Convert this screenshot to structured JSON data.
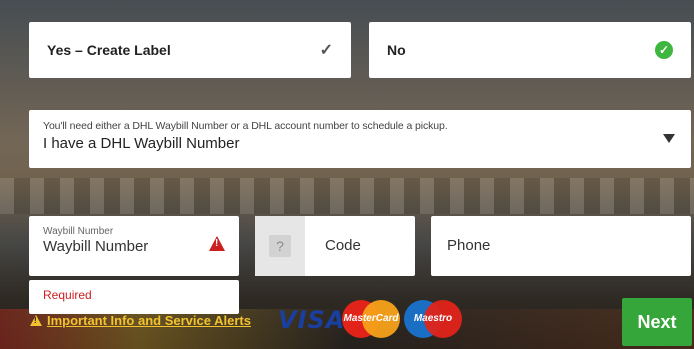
{
  "label_choice": {
    "yes_label": "Yes – Create Label",
    "no_label": "No",
    "yes_check": "✓",
    "no_check": "✓"
  },
  "pickup_select": {
    "hint": "You'll need either a DHL Waybill Number or a DHL account number to schedule a pickup.",
    "selected": "I have a DHL Waybill Number"
  },
  "waybill": {
    "label": "Waybill Number",
    "placeholder": "Waybill Number",
    "error": "Required"
  },
  "phone_code": {
    "help": "?",
    "placeholder": "Code"
  },
  "phone": {
    "placeholder": "Phone"
  },
  "alerts": {
    "link_text": "Important Info and Service Alerts"
  },
  "payment_logos": {
    "visa": "VISA",
    "mastercard": "MasterCard",
    "maestro": "Maestro"
  },
  "next_button": "Next",
  "colors": {
    "accent_green": "#35a63a",
    "error_red": "#cc1f1f",
    "alert_yellow": "#f2c230"
  }
}
